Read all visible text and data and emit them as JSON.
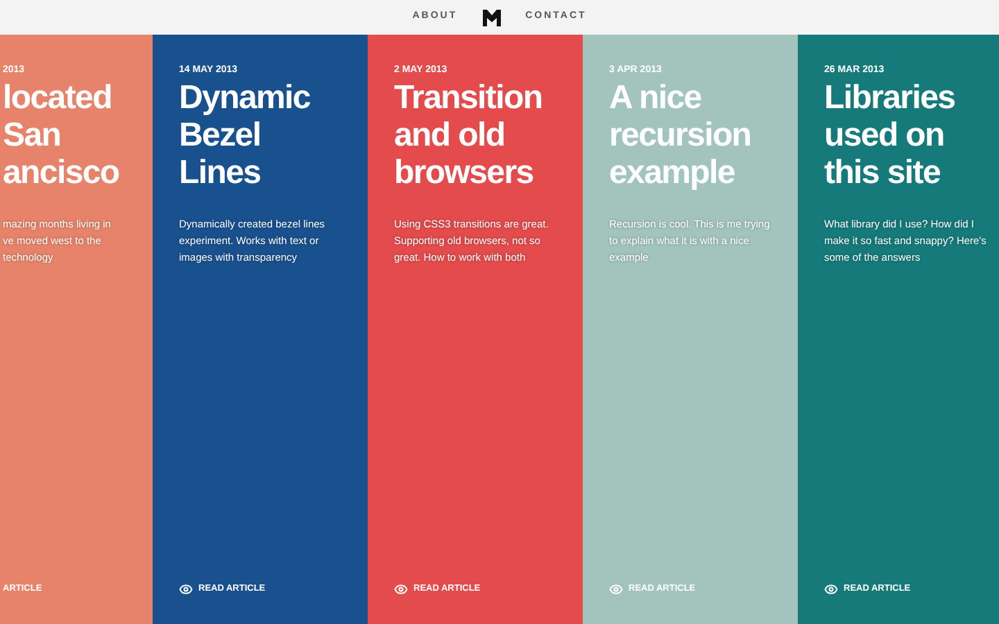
{
  "nav": {
    "links": [
      "ABOUT",
      "CONTACT"
    ]
  },
  "articles": [
    {
      "date": "2013",
      "title_lines": [
        "located",
        "San",
        "ancisco"
      ],
      "excerpt_lines": [
        "mazing months living in",
        "ve moved west to the",
        "technology"
      ],
      "link": "ARTICLE",
      "color": "#e8836b",
      "cut": true
    },
    {
      "date": "14 MAY 2013",
      "title_lines": [
        "Dynamic",
        "Bezel",
        "Lines"
      ],
      "excerpt_lines": [
        "Dynamically created bezel lines",
        "experiment. Works with text or",
        "images with transparency"
      ],
      "link": "READ ARTICLE",
      "color": "#19518f",
      "cut": false
    },
    {
      "date": "2 MAY 2013",
      "title_lines": [
        "Transition",
        "and old",
        "browsers"
      ],
      "excerpt_lines": [
        "Using CSS3 transitions are great.",
        "Supporting old browsers, not so",
        "great. How to work with both"
      ],
      "link": "READ ARTICLE",
      "color": "#e44b4c",
      "cut": false
    },
    {
      "date": "3 APR 2013",
      "title_lines": [
        "A nice",
        "recursion",
        "example"
      ],
      "excerpt_lines": [
        "Recursion is cool. This is me trying",
        "to explain what it is with a nice",
        "example"
      ],
      "link": "READ ARTICLE",
      "color": "#a2c4bd",
      "cut": false
    },
    {
      "date": "26 MAR 2013",
      "title_lines": [
        "Libraries",
        "used on",
        "this site"
      ],
      "excerpt_lines": [
        "What library did I use? How did I",
        "make it so fast and snappy? Here's",
        "some of the answers"
      ],
      "link": "READ ARTICLE",
      "color": "#177a7a",
      "cut": false
    }
  ]
}
